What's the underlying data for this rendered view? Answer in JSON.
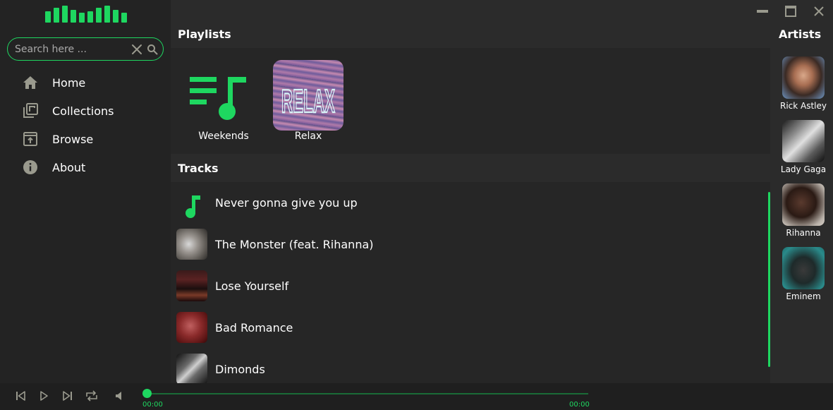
{
  "search": {
    "placeholder": "Search here ..."
  },
  "nav": [
    {
      "label": "Home",
      "icon": "home-icon"
    },
    {
      "label": "Collections",
      "icon": "collections-icon"
    },
    {
      "label": "Browse",
      "icon": "browse-icon"
    },
    {
      "label": "About",
      "icon": "info-icon"
    }
  ],
  "sections": {
    "playlists": "Playlists",
    "tracks": "Tracks",
    "artists": "Artists"
  },
  "playlists": [
    {
      "name": "Weekends"
    },
    {
      "name": "Relax",
      "cover_text": "RELAX"
    }
  ],
  "tracks": [
    {
      "title": "Never gonna give you up"
    },
    {
      "title": "The Monster (feat. Rihanna)"
    },
    {
      "title": "Lose Yourself"
    },
    {
      "title": "Bad Romance"
    },
    {
      "title": "Dimonds"
    }
  ],
  "artists": [
    {
      "name": "Rick Astley"
    },
    {
      "name": "Lady Gaga"
    },
    {
      "name": "Rihanna"
    },
    {
      "name": "Eminem"
    }
  ],
  "player": {
    "elapsed": "00:00",
    "duration": "00:00",
    "progress": 0
  },
  "colors": {
    "accent": "#1ed760",
    "background": "#2b2b2b",
    "sidebar": "#232323",
    "panel": "#262626",
    "icon_gray": "#9a9a8e"
  }
}
